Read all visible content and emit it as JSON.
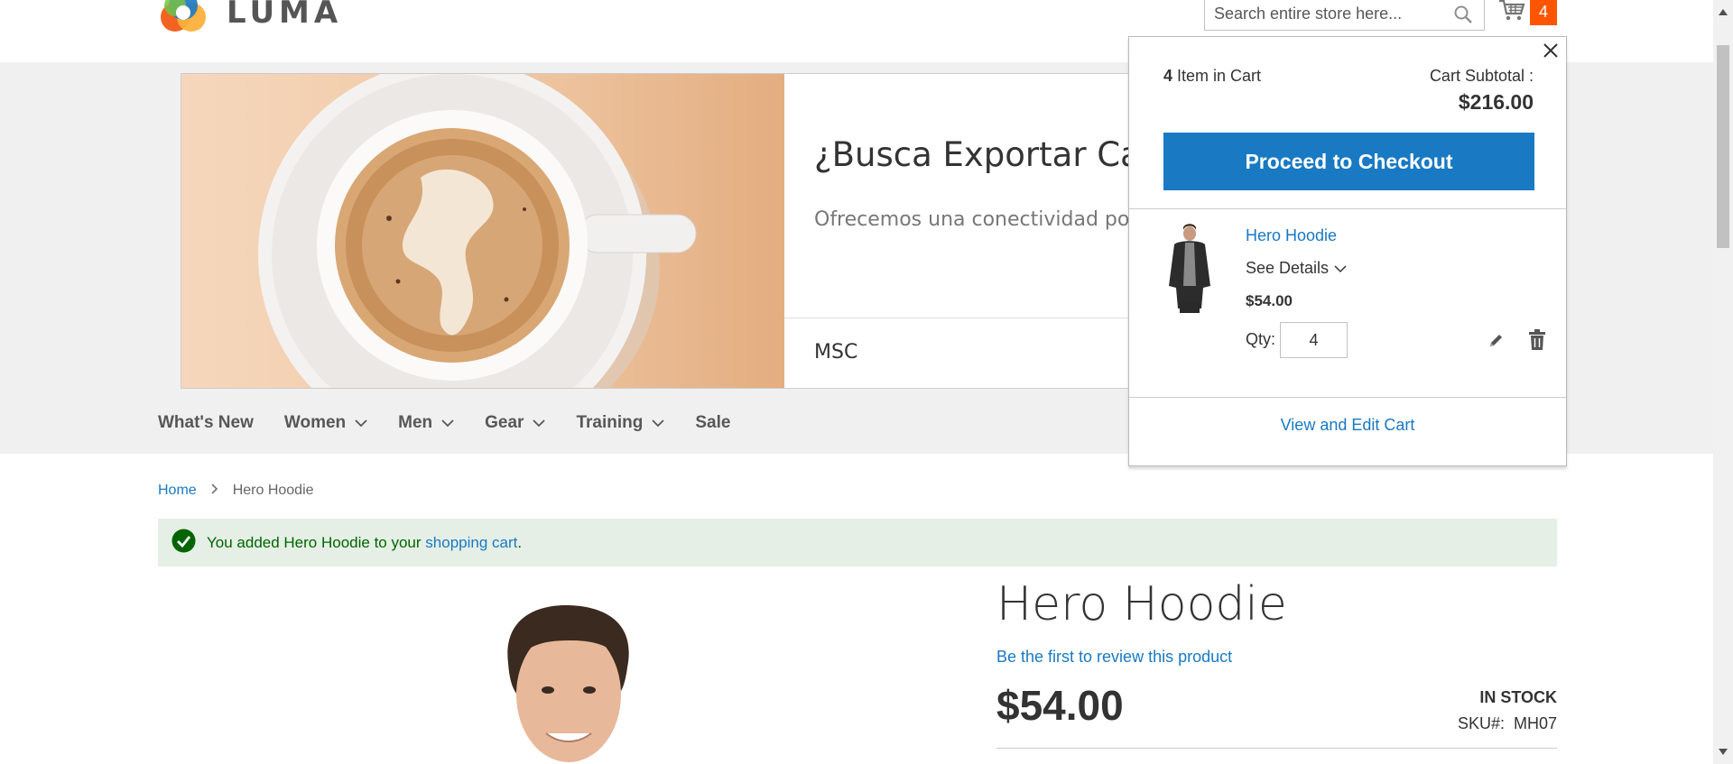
{
  "header": {
    "logo_text": "LUMA",
    "search_placeholder": "Search entire store here...",
    "cart_count": "4",
    "accent": "#ff5501"
  },
  "banner": {
    "title": "¿Busca Exportar Cafe",
    "subtitle": "Ofrecemos una conectividad portu seguridad.",
    "footer": "MSC"
  },
  "nav": {
    "items": [
      {
        "label": "What's New"
      },
      {
        "label": "Women"
      },
      {
        "label": "Men"
      },
      {
        "label": "Gear"
      },
      {
        "label": "Training"
      },
      {
        "label": "Sale"
      }
    ]
  },
  "breadcrumb": {
    "home": "Home",
    "current": "Hero Hoodie"
  },
  "message": {
    "text_before": "You added Hero Hoodie to your ",
    "link": "shopping cart",
    "text_after": ".",
    "color": "#006400"
  },
  "product": {
    "title": "Hero Hoodie",
    "review_link": "Be the first to review this product",
    "price": "$54.00",
    "stock": "IN STOCK",
    "sku_label": "SKU#:",
    "sku": "MH07"
  },
  "minicart": {
    "count": "4",
    "count_label": "Item in Cart",
    "subtotal_label": "Cart Subtotal :",
    "subtotal": "$216.00",
    "checkout_label": "Proceed to Checkout",
    "item": {
      "name": "Hero Hoodie",
      "details_label": "See Details",
      "price": "$54.00",
      "qty_label": "Qty:",
      "qty": "4"
    },
    "view_cart_label": "View and Edit Cart",
    "button_color": "#1979c3"
  }
}
